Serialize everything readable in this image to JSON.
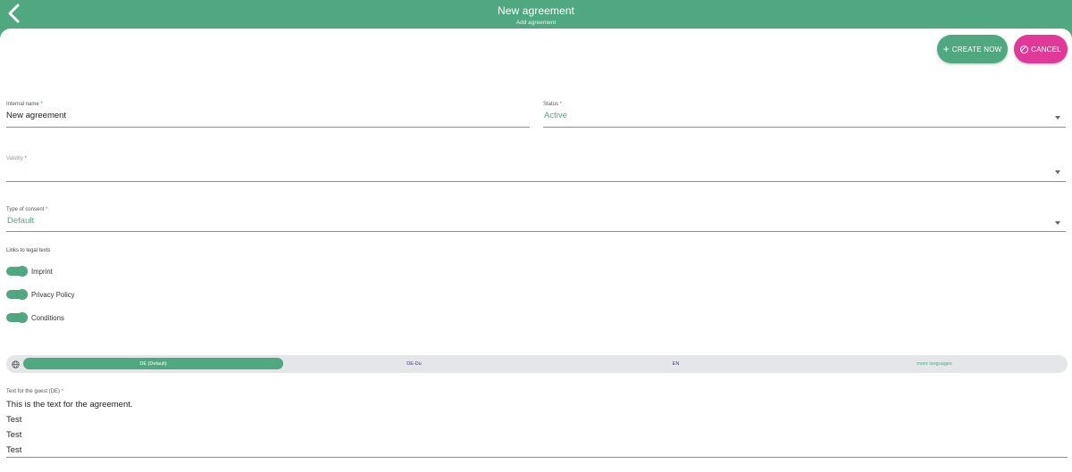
{
  "header": {
    "title": "New agreement",
    "subtitle": "Add agreement"
  },
  "actions": {
    "create_label": "CREATE NOW",
    "cancel_label": "CANCEL"
  },
  "form": {
    "internal_name": {
      "label": "Internal name",
      "required": "*",
      "value": "New agreement"
    },
    "status": {
      "label": "Status",
      "required": "*",
      "value": "Active"
    },
    "validity": {
      "label": "Validity",
      "required": "*",
      "value": ""
    },
    "consent_type": {
      "label": "Type of consent",
      "required": "*",
      "value": "Default"
    }
  },
  "links": {
    "label": "Links to legal texts",
    "items": [
      {
        "label": "Imprint",
        "on": true
      },
      {
        "label": "Privacy Policy",
        "on": true
      },
      {
        "label": "Conditions",
        "on": true
      }
    ]
  },
  "languages": {
    "tabs": [
      "DE (Default)",
      "DE-Du",
      "EN",
      "more languages"
    ],
    "active": "DE (Default)"
  },
  "guest_text": {
    "label": "Text for the guest (DE)",
    "required": "*",
    "lines": [
      "This is the text for the agreement.",
      "Test",
      "Test",
      "Test"
    ]
  },
  "colors": {
    "primary": "#4fa87f",
    "cancel": "#e0399a",
    "tab_text": "#3b3b9c"
  },
  "icons": {
    "back": "chevron-left-icon",
    "create": "plus-icon",
    "cancel": "ban-icon",
    "language": "globe-icon",
    "dropdown": "caret-down-icon"
  }
}
